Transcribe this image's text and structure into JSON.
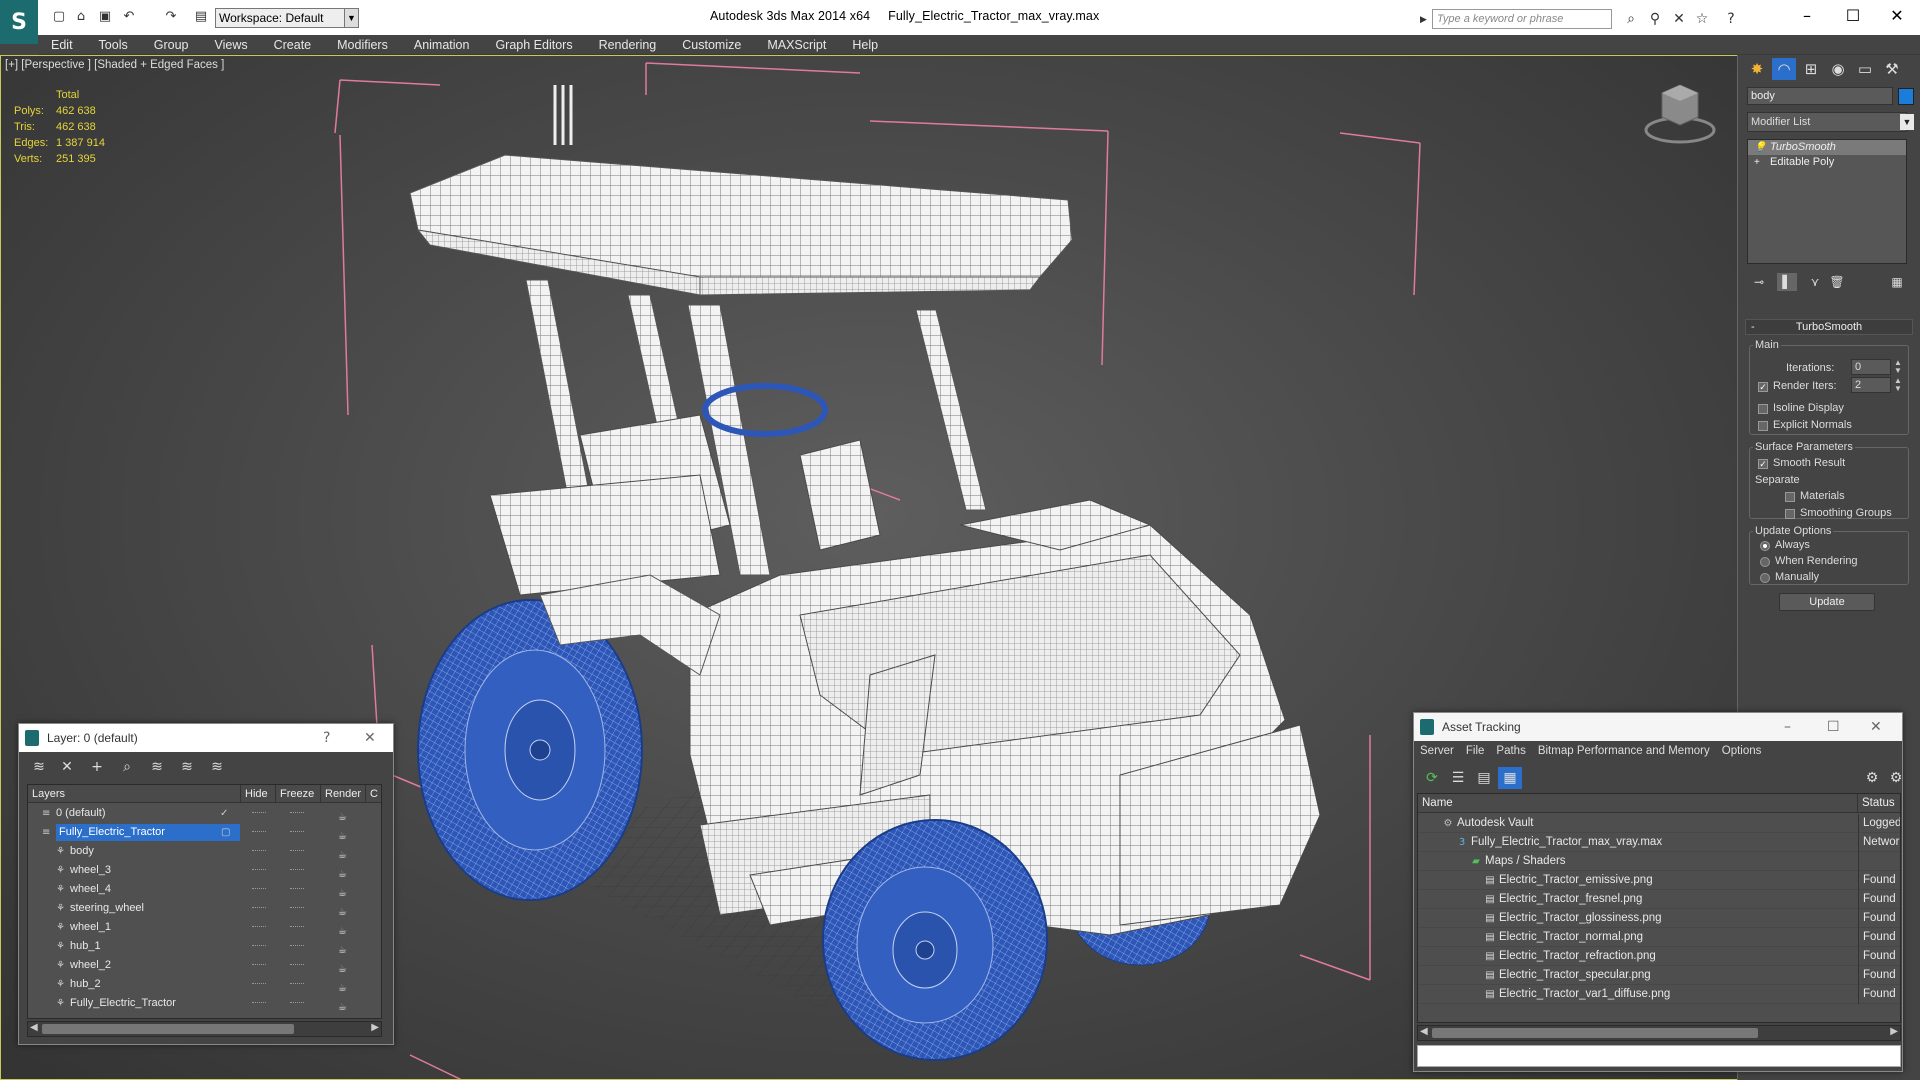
{
  "titlebar": {
    "app_name": "Autodesk 3ds Max  2014 x64",
    "file_name": "Fully_Electric_Tractor_max_vray.max",
    "workspace": "Workspace: Default",
    "search_placeholder": "Type a keyword or phrase"
  },
  "menu": [
    "Edit",
    "Tools",
    "Group",
    "Views",
    "Create",
    "Modifiers",
    "Animation",
    "Graph Editors",
    "Rendering",
    "Customize",
    "MAXScript",
    "Help"
  ],
  "viewport": {
    "label": "[+] [Perspective ] [Shaded + Edged Faces ]",
    "stats": {
      "header": "Total",
      "rows": [
        {
          "key": "Polys:",
          "value": "462 638"
        },
        {
          "key": "Tris:",
          "value": "462 638"
        },
        {
          "key": "Edges:",
          "value": "1 387 914"
        },
        {
          "key": "Verts:",
          "value": "251 395"
        }
      ]
    },
    "colors": {
      "wire": "#e8e8e8",
      "wheel": "#1f4fb0",
      "bbox": "#e07aa0",
      "grid": "#2a2a2a"
    }
  },
  "command_panel": {
    "object_name": "body",
    "object_color": "#1a7dd9",
    "modifier_list": "Modifier List",
    "stack": [
      {
        "label": "TurboSmooth",
        "selected": true
      },
      {
        "label": "Editable Poly",
        "selected": false
      }
    ],
    "turbosmooth": {
      "title": "TurboSmooth",
      "main": "Main",
      "iterations_label": "Iterations:",
      "iterations": "0",
      "render_iters_label": "Render Iters:",
      "render_iters": "2",
      "isoline": "Isoline Display",
      "explicit": "Explicit Normals",
      "surface_params": "Surface Parameters",
      "smooth_result": "Smooth Result",
      "separate": "Separate",
      "materials": "Materials",
      "smoothing_groups": "Smoothing Groups",
      "update_options": "Update Options",
      "always": "Always",
      "when_rendering": "When Rendering",
      "manually": "Manually",
      "update": "Update"
    }
  },
  "layer_window": {
    "title": "Layer: 0 (default)",
    "help": "?",
    "columns": [
      "Layers",
      "Hide",
      "Freeze",
      "Render",
      "C"
    ],
    "rows": [
      {
        "name": "0 (default)",
        "level": 1,
        "type": "layer"
      },
      {
        "name": "Fully_Electric_Tractor",
        "level": 1,
        "type": "layer",
        "selected": true
      },
      {
        "name": "body",
        "level": 2,
        "type": "object"
      },
      {
        "name": "wheel_3",
        "level": 2,
        "type": "object"
      },
      {
        "name": "wheel_4",
        "level": 2,
        "type": "object"
      },
      {
        "name": "steering_wheel",
        "level": 2,
        "type": "object"
      },
      {
        "name": "wheel_1",
        "level": 2,
        "type": "object"
      },
      {
        "name": "hub_1",
        "level": 2,
        "type": "object"
      },
      {
        "name": "wheel_2",
        "level": 2,
        "type": "object"
      },
      {
        "name": "hub_2",
        "level": 2,
        "type": "object"
      },
      {
        "name": "Fully_Electric_Tractor",
        "level": 2,
        "type": "object"
      }
    ]
  },
  "asset_window": {
    "title": "Asset Tracking",
    "menu": [
      "Server",
      "File",
      "Paths",
      "Bitmap Performance and Memory",
      "Options"
    ],
    "columns": [
      "Name",
      "Status"
    ],
    "rows": [
      {
        "name": "Autodesk Vault",
        "status": "Logged",
        "level": 1,
        "icon": "vault"
      },
      {
        "name": "Fully_Electric_Tractor_max_vray.max",
        "status": "Network",
        "level": 2,
        "icon": "max"
      },
      {
        "name": "Maps / Shaders",
        "status": "",
        "level": 3,
        "icon": "folder"
      },
      {
        "name": "Electric_Tractor_emissive.png",
        "status": "Found",
        "level": 4,
        "icon": "file"
      },
      {
        "name": "Electric_Tractor_fresnel.png",
        "status": "Found",
        "level": 4,
        "icon": "file"
      },
      {
        "name": "Electric_Tractor_glossiness.png",
        "status": "Found",
        "level": 4,
        "icon": "file"
      },
      {
        "name": "Electric_Tractor_normal.png",
        "status": "Found",
        "level": 4,
        "icon": "file"
      },
      {
        "name": "Electric_Tractor_refraction.png",
        "status": "Found",
        "level": 4,
        "icon": "file"
      },
      {
        "name": "Electric_Tractor_specular.png",
        "status": "Found",
        "level": 4,
        "icon": "file"
      },
      {
        "name": "Electric_Tractor_var1_diffuse.png",
        "status": "Found",
        "level": 4,
        "icon": "file"
      }
    ]
  }
}
